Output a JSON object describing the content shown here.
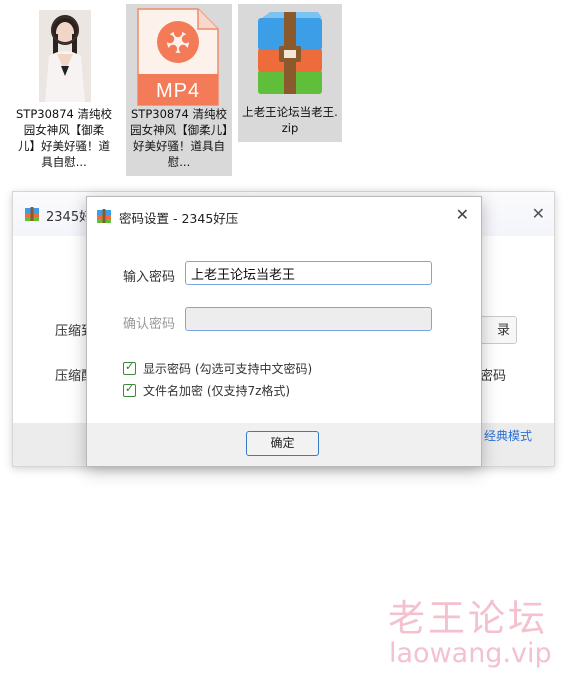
{
  "files": [
    {
      "label": "STP30874 清纯校园女神风【御柔儿】好美好骚！道具自慰...",
      "icon": "video-thumbnail",
      "selected": false
    },
    {
      "label": "STP30874 清纯校园女神风【御柔儿】好美好骚！道具自慰...",
      "icon": "mp4-file-icon",
      "badge": "MP4",
      "selected": true
    },
    {
      "label": "上老王论坛当老王.zip",
      "icon": "zip-archive-icon",
      "selected": true
    }
  ],
  "background_window": {
    "title": "2345好",
    "row1_label": "压缩到",
    "row2_label": "压缩配",
    "button_label": "录",
    "right_text": "密码",
    "link": "经典模式"
  },
  "dialog": {
    "title": "密码设置 - 2345好压",
    "password_label": "输入密码",
    "password_value": "上老王论坛当老王",
    "confirm_label": "确认密码",
    "confirm_value": "",
    "show_password": {
      "label": "显示密码 (勾选可支持中文密码)",
      "checked": true
    },
    "encrypt_names": {
      "label": "文件名加密 (仅支持7z格式)",
      "checked": true
    },
    "ok_label": "确定"
  },
  "watermark": {
    "name": "老王论坛",
    "url": "laowang.vip"
  },
  "colors": {
    "accent": "#3a78c9",
    "mp4_badge": "#f37b57",
    "watermark": "#f4c1ce",
    "check": "#2e7d32"
  }
}
